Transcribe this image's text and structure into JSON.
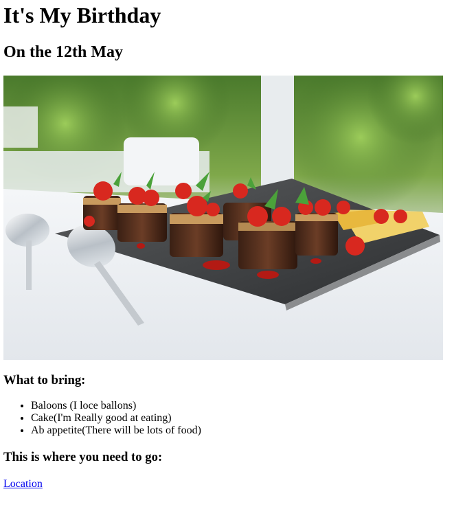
{
  "page": {
    "title": "It's My Birthday",
    "subtitle": "On the 12th May"
  },
  "hero_image": {
    "alt_description": "Chocolate mousse cakes with strawberries on a tray"
  },
  "bring": {
    "heading": "What to bring:",
    "items": [
      {
        "label": "Baloons (I loce ballons)"
      },
      {
        "label": "Cake(I'm Really good at eating)"
      },
      {
        "label": "Ab appetite(There will be lots of food)"
      }
    ]
  },
  "location": {
    "heading": "This is where you need to go:",
    "link_label": "Location"
  },
  "colors": {
    "link": "#0000ee",
    "text": "#000000",
    "background": "#ffffff"
  }
}
